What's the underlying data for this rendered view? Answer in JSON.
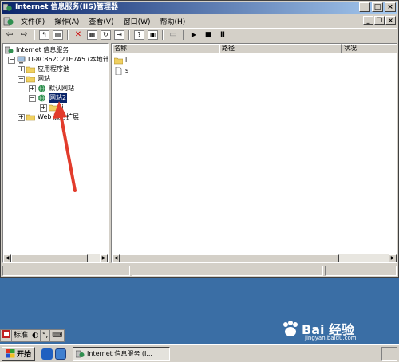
{
  "window": {
    "title": "Internet 信息服务(IIS)管理器",
    "controls": {
      "minimize": "_",
      "maximize": "□",
      "close": "×"
    }
  },
  "menu": {
    "items": [
      "文件(F)",
      "操作(A)",
      "查看(V)",
      "窗口(W)",
      "帮助(H)"
    ],
    "mdi_controls": {
      "minimize": "_",
      "restore": "❐",
      "close": "×"
    }
  },
  "toolbar": {
    "buttons": [
      "back",
      "forward",
      "up-folder",
      "show-hide-console-tree",
      "delete",
      "properties",
      "refresh",
      "export-list",
      "help",
      "help-topics",
      "computer",
      "start",
      "stop",
      "pause"
    ]
  },
  "tree": {
    "items": [
      {
        "label": "Internet 信息服务",
        "indent": 0,
        "icon": "iis-icon"
      },
      {
        "label": "LI-8C862C21E7A5 (本地计",
        "indent": 1,
        "icon": "computer-icon",
        "expander": "−"
      },
      {
        "label": "应用程序池",
        "indent": 2,
        "icon": "folder-icon",
        "expander": "+"
      },
      {
        "label": "网站",
        "indent": 2,
        "icon": "folder-icon",
        "expander": "−"
      },
      {
        "label": "默认网站",
        "indent": 3,
        "icon": "globe-icon",
        "expander": "+"
      },
      {
        "label": "网站2",
        "indent": 3,
        "icon": "globe-icon",
        "expander": "−",
        "selected": true
      },
      {
        "label": "li",
        "indent": 4,
        "icon": "folder-icon",
        "expander": "+"
      },
      {
        "label": "Web 服务扩展",
        "indent": 2,
        "icon": "folder-icon",
        "expander": "+"
      }
    ]
  },
  "list": {
    "columns": [
      "名称",
      "路径",
      "状况"
    ],
    "rows": [
      {
        "name": "li",
        "icon": "folder-icon"
      },
      {
        "name": "s",
        "icon": "file-icon"
      }
    ]
  },
  "ime": {
    "mode": "标准",
    "moon": "◐",
    "punct": "°,",
    "keyboard": "⌨"
  },
  "taskbar": {
    "start_label": "开始",
    "task_label": "Internet 信息服务 (I..."
  },
  "watermark": {
    "brand": "Bai 经验",
    "url": "jingyan.baidu.com"
  },
  "colors": {
    "title_start": "#0a246a",
    "title_end": "#a6caf0",
    "desktop": "#3a6ea5",
    "selection": "#0a246a",
    "arrow": "#e23c2c"
  }
}
